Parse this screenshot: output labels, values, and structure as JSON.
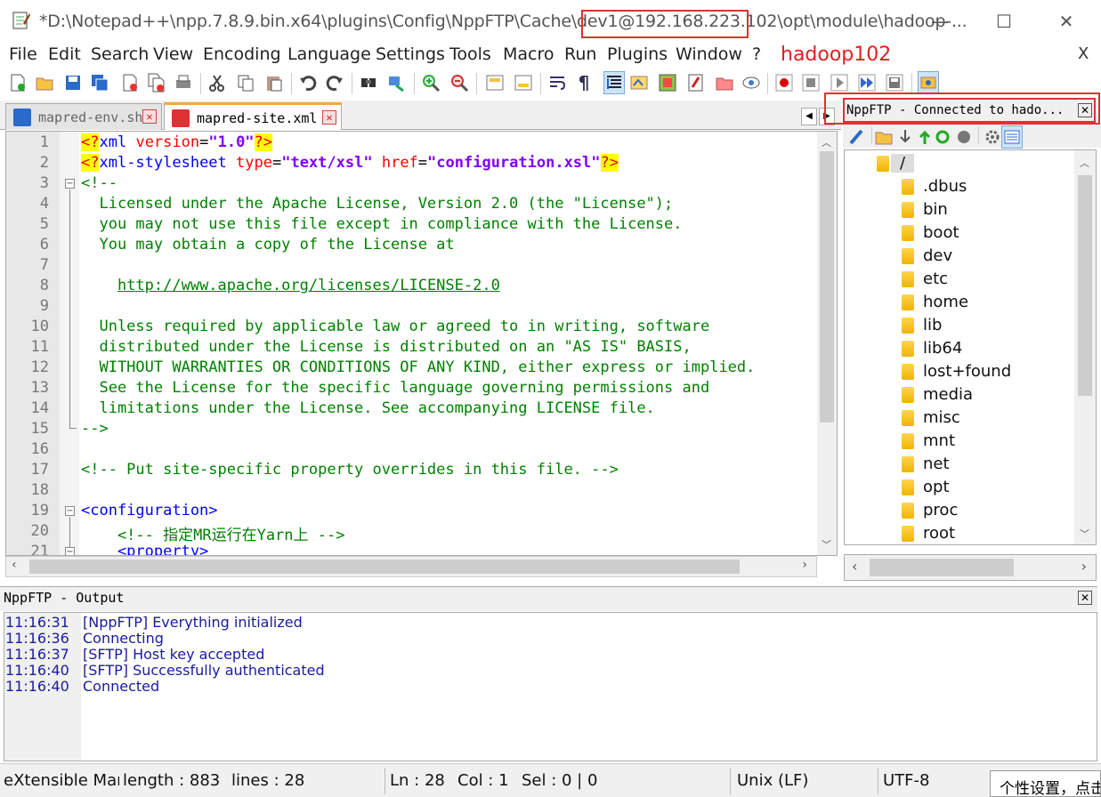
{
  "window": {
    "title": "*D:\\Notepad++\\npp.7.8.9.bin.x64\\plugins\\Config\\NppFTP\\Cache\\dev1@192.168.223.102\\opt\\module\\hadoop-...",
    "minimize": "—",
    "maximize": "☐",
    "close": "✕"
  },
  "menu": {
    "items": [
      "File",
      "Edit",
      "Search",
      "View",
      "Encoding",
      "Language",
      "Settings",
      "Tools",
      "Macro",
      "Run",
      "Plugins",
      "Window",
      "?"
    ],
    "close": "X"
  },
  "annotation": {
    "label": "hadoop102",
    "color": "#e02020"
  },
  "tabs": [
    {
      "label": "mapred-env.sh",
      "active": false
    },
    {
      "label": "mapred-site.xml",
      "active": true
    }
  ],
  "editor": {
    "lines": [
      "1",
      "2",
      "3",
      "4",
      "5",
      "6",
      "7",
      "8",
      "9",
      "10",
      "11",
      "12",
      "13",
      "14",
      "15",
      "16",
      "17",
      "18",
      "19",
      "20",
      "21"
    ]
  },
  "ftp": {
    "header": "NppFTP - Connected to hado...",
    "close": "✕",
    "tree": {
      "root": "/",
      "items": [
        ".dbus",
        "bin",
        "boot",
        "dev",
        "etc",
        "home",
        "lib",
        "lib64",
        "lost+found",
        "media",
        "misc",
        "mnt",
        "net",
        "opt",
        "proc",
        "root"
      ]
    }
  },
  "output": {
    "header": "NppFTP - Output",
    "close": "✕",
    "rows": [
      {
        "time": "11:16:31",
        "msg": "[NppFTP] Everything initialized"
      },
      {
        "time": "11:16:36",
        "msg": "Connecting"
      },
      {
        "time": "11:16:37",
        "msg": "[SFTP] Host key accepted"
      },
      {
        "time": "11:16:40",
        "msg": "[SFTP] Successfully authenticated"
      },
      {
        "time": "11:16:40",
        "msg": "Connected"
      }
    ]
  },
  "status": {
    "filetype": "eXtensible Mar",
    "length": "length : 883",
    "lines": "lines : 28",
    "ln": "Ln : 28",
    "col": "Col : 1",
    "sel": "Sel : 0 | 0",
    "eol": "Unix (LF)",
    "encoding": "UTF-8",
    "tooltip": "个性设置，点击"
  },
  "colors": {
    "highlight_box": "#e03030",
    "comment": "#008000",
    "tag": "#0000ff",
    "attr": "#ff0000",
    "string": "#8000ff",
    "output_text": "#1a1aa0"
  }
}
